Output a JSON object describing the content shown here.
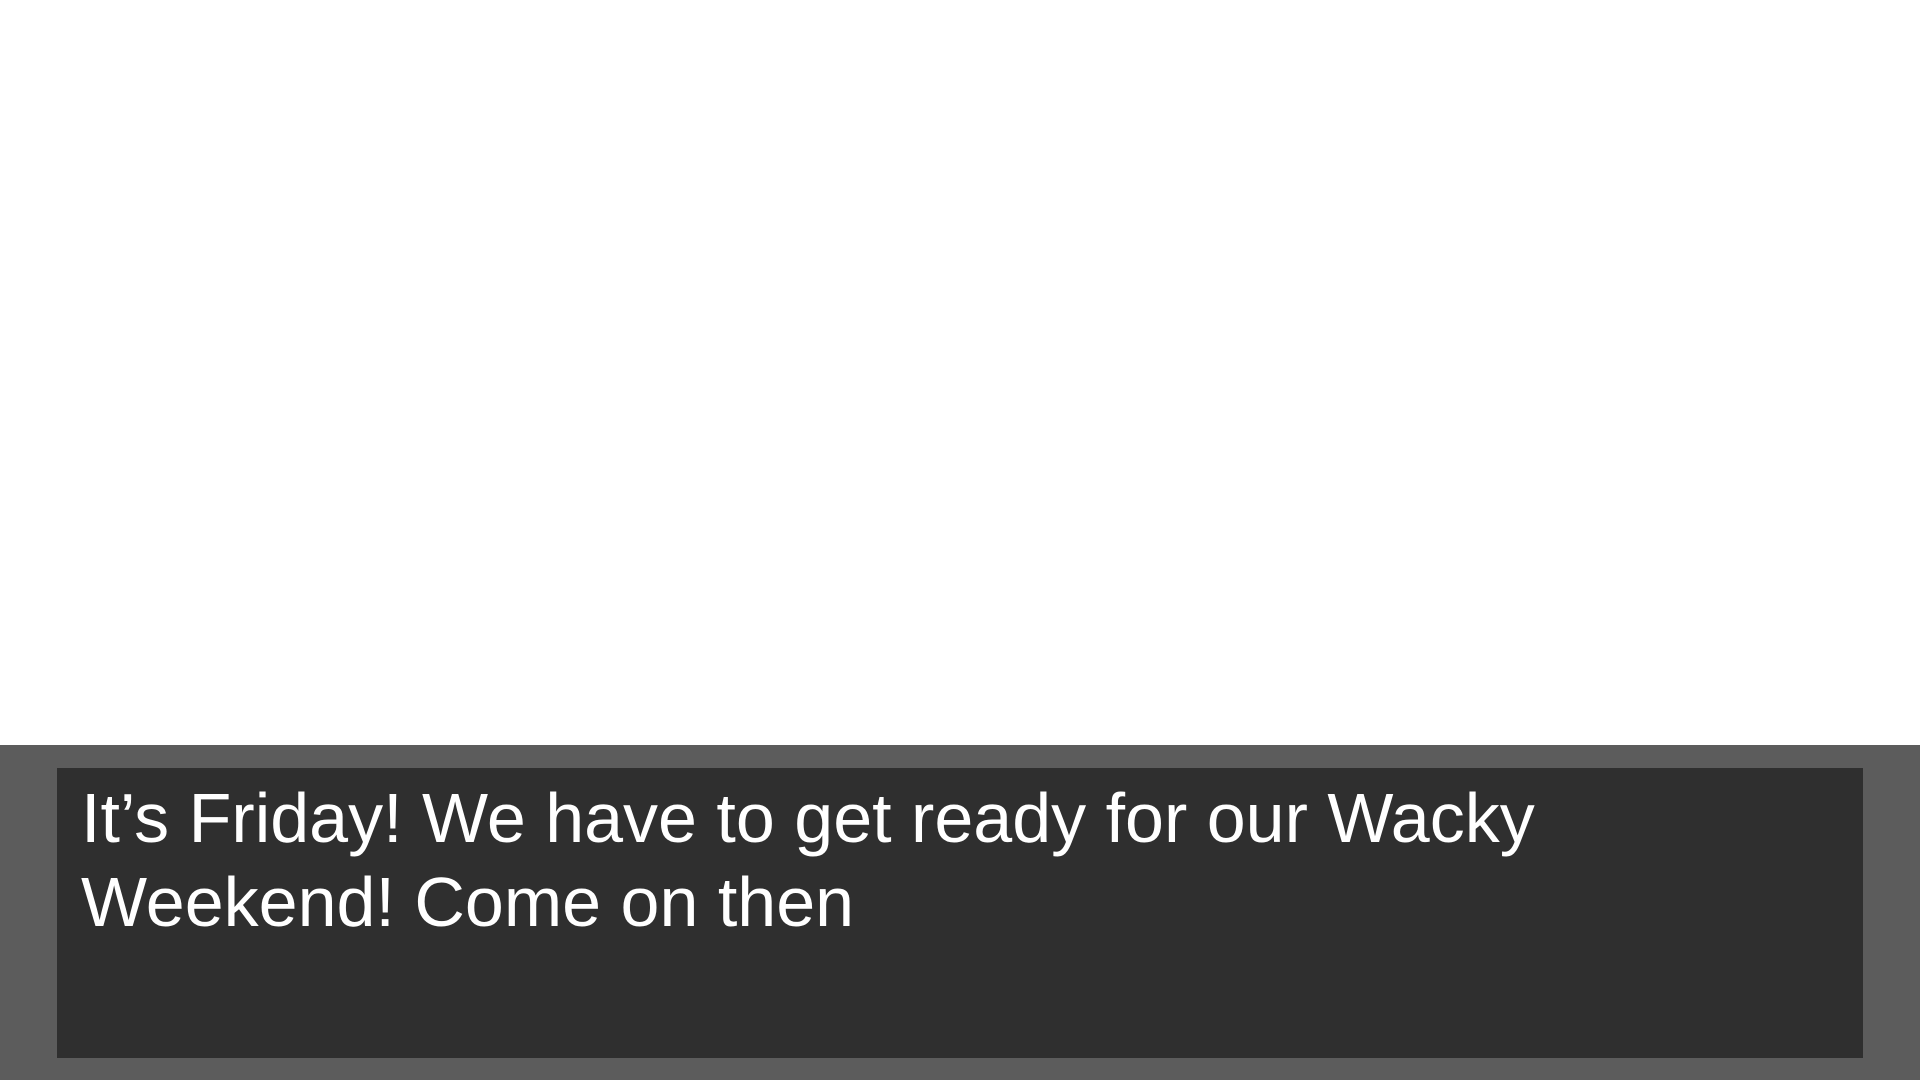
{
  "dialogue": {
    "text": "It’s Friday! We have to get ready for our Wacky Weekend! Come on then"
  },
  "colors": {
    "scene_background": "#ffffff",
    "dialogue_frame": "#5c5c5c",
    "dialogue_box": "#2f2f2f",
    "dialogue_text": "#ffffff"
  }
}
